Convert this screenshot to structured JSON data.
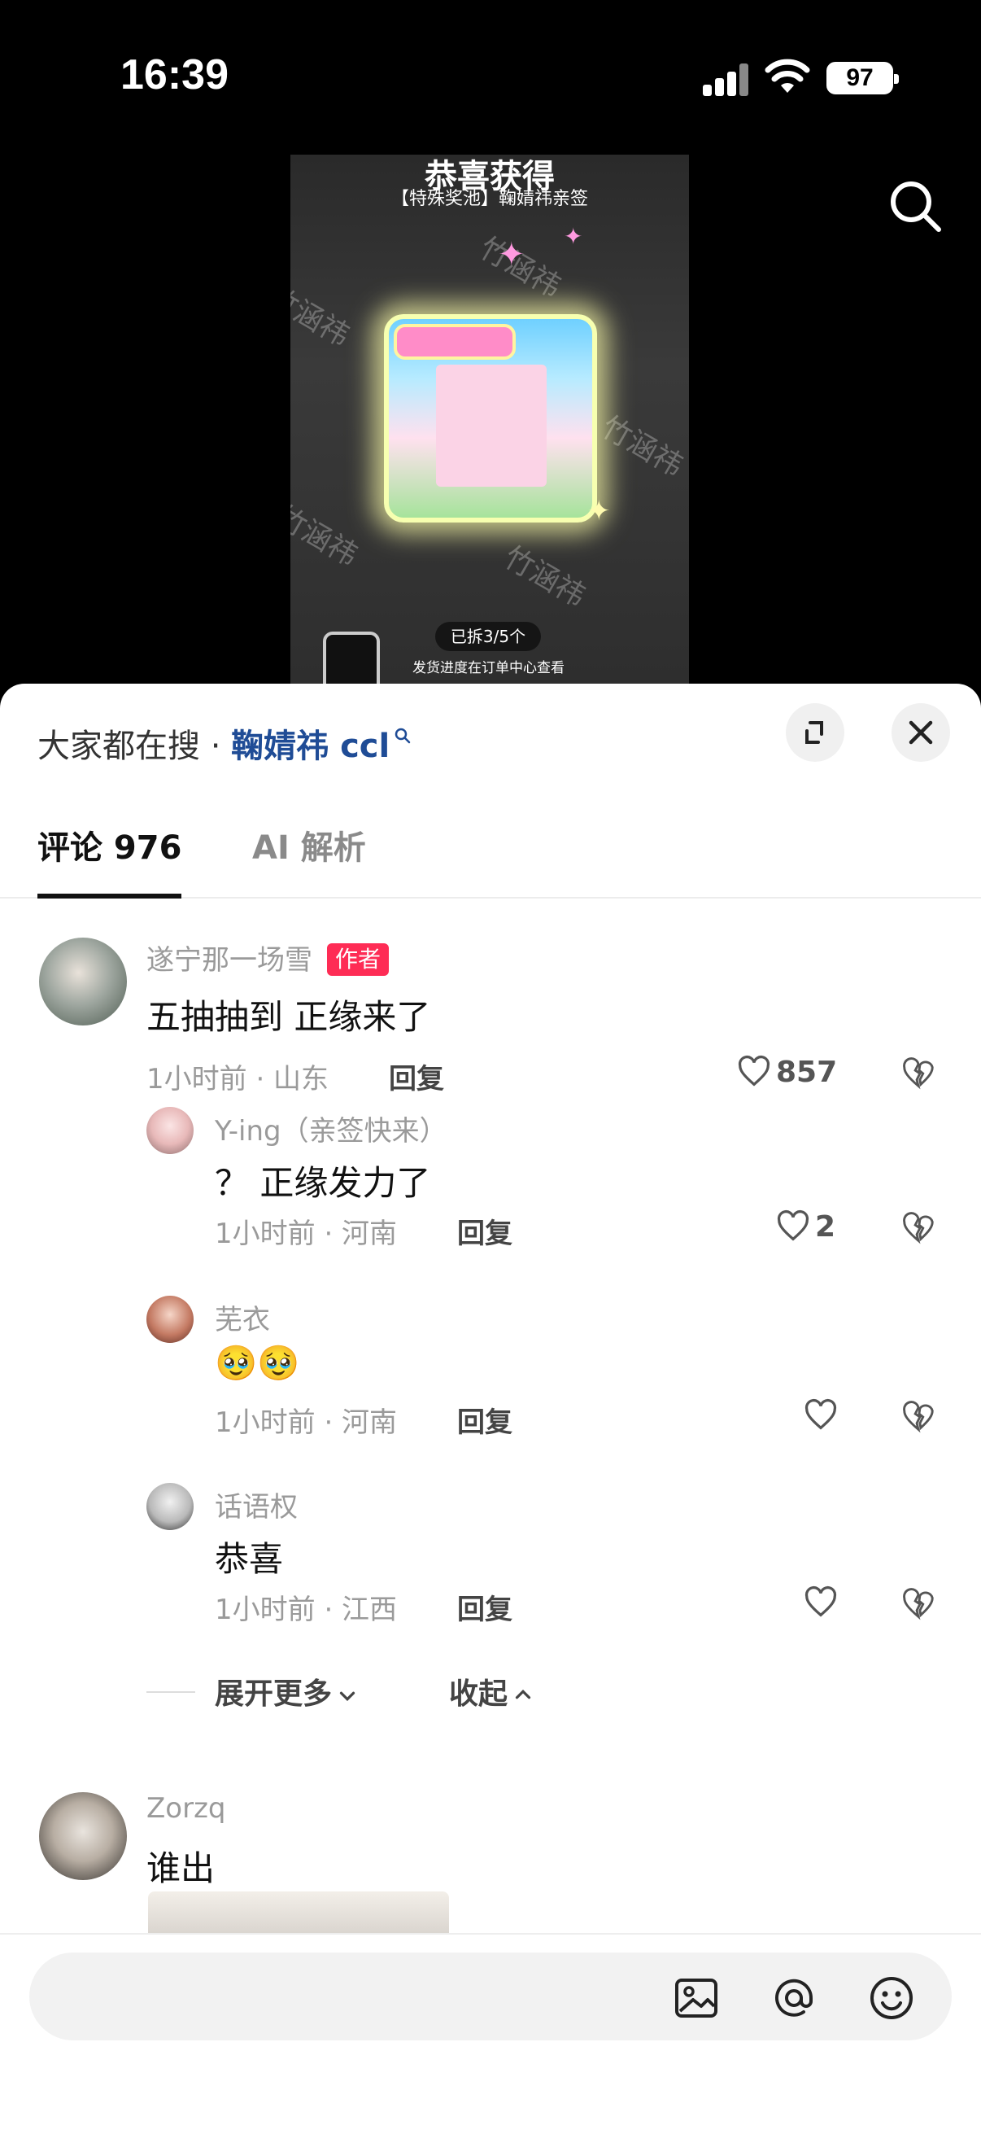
{
  "status_bar": {
    "time": "16:39",
    "battery": "97"
  },
  "video": {
    "title": "恭喜获得",
    "subtitle": "【特殊奖池】鞠婧祎亲签",
    "watermark": "竹涵祎",
    "progress": "已拆3/5个",
    "hint": "发货进度在订单中心查看"
  },
  "sheet": {
    "hot_search_label": "大家都在搜 · ",
    "hot_search_keyword": "鞠婧祎 ccl",
    "tabs": [
      {
        "label": "评论 976"
      },
      {
        "label": "AI 解析"
      }
    ]
  },
  "comments": [
    {
      "user": "遂宁那一场雪",
      "badge": "作者",
      "text": "五抽抽到 正缘来了",
      "meta": "1小时前 · 山东",
      "reply": "回复",
      "likes": "857"
    },
    {
      "user": "Y-ing（亲签快来）",
      "text": "？ 正缘发力了",
      "meta": "1小时前 · 河南",
      "reply": "回复",
      "likes": "2"
    },
    {
      "user": "芜衣",
      "text": "🥹🥹",
      "meta": "1小时前 · 河南",
      "reply": "回复",
      "likes": ""
    },
    {
      "user": "话语权",
      "text": "恭喜",
      "meta": "1小时前 · 江西",
      "reply": "回复",
      "likes": ""
    },
    {
      "user": "Zorzq",
      "text": "谁出"
    }
  ],
  "thread": {
    "expand_more": "展开更多",
    "collapse": "收起"
  },
  "input": {
    "placeholder": ""
  },
  "colors": {
    "accent": "#fe2c55",
    "keyword": "#1f4c96"
  }
}
